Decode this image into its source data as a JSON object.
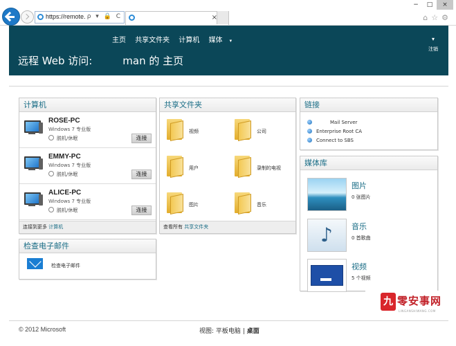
{
  "browser": {
    "address": "https://remote.",
    "address_tools": "ρ ▾ 🔒 C",
    "tab_close": "×",
    "window_controls": [
      "−",
      "□",
      "×"
    ],
    "right_icons": "⌂☆⚙"
  },
  "header": {
    "menu": [
      "主页",
      "共享文件夹",
      "计算机",
      "媒体"
    ],
    "menu_caret": "▾",
    "signout_caret": "▾",
    "signout_label": "注销",
    "title_prefix": "远程 Web 访问:",
    "title_suffix": "man 的 主页"
  },
  "computers": {
    "title": "计算机",
    "items": [
      {
        "name": "ROSE-PC",
        "os": "Windows 7 专业版",
        "status": "脱机/休眠",
        "button": "连接"
      },
      {
        "name": "EMMY-PC",
        "os": "Windows 7 专业版",
        "status": "脱机/休眠",
        "button": "连接"
      },
      {
        "name": "ALICE-PC",
        "os": "Windows 7 专业版",
        "status": "脱机/休眠",
        "button": "连接"
      }
    ],
    "footer_text": "连接到更多",
    "footer_link": "计算机"
  },
  "shared_folders": {
    "title": "共享文件夹",
    "items": [
      "视频",
      "公司",
      "用户",
      "录制的电视",
      "图片",
      "音乐"
    ],
    "footer_text": "查看所有",
    "footer_link": "共享文件夹"
  },
  "links": {
    "title": "链接",
    "items": [
      "Mail Server",
      "Enterprise Root CA",
      "Connect to SBS"
    ]
  },
  "media": {
    "title": "媒体库",
    "items": [
      {
        "title": "图片",
        "count": "0 张图片"
      },
      {
        "title": "音乐",
        "count": "0 首歌曲"
      },
      {
        "title": "视频",
        "count": "5 个视频"
      }
    ]
  },
  "email": {
    "title": "检查电子邮件",
    "item": "检查电子邮件"
  },
  "footer": {
    "copyright": "© 2012 Microsoft",
    "view_label": "视图:",
    "view_tablet": "平板电脑",
    "separator": "|",
    "view_desktop": "桌面"
  },
  "watermark": {
    "seal": "九",
    "text": "零安事网",
    "sub": "LINGANSHIWANG.COM"
  }
}
